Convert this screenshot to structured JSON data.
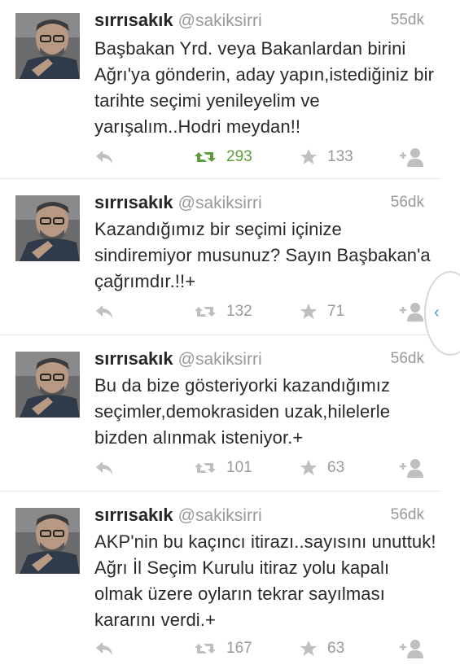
{
  "tweets": [
    {
      "name": "sırrısakık",
      "handle": "@sakiksirri",
      "time": "55dk",
      "text": "Başbakan Yrd. veya Bakanlardan birini Ağrı'ya gönderin, aday yapın,istediğiniz bir tarihte seçimi yenileyelim ve yarışalım..Hodri meydan!!",
      "retweets": "293",
      "favorites": "133",
      "retweeted": true
    },
    {
      "name": "sırrısakık",
      "handle": "@sakiksirri",
      "time": "56dk",
      "text": "Kazandığımız bir seçimi içinize sindiremiyor musunuz? Sayın Başbakan'a çağrımdır.!!+",
      "retweets": "132",
      "favorites": "71",
      "retweeted": false
    },
    {
      "name": "sırrısakık",
      "handle": "@sakiksirri",
      "time": "56dk",
      "text": "Bu da bize gösteriyorki kazandığımız seçimler,demokrasiden uzak,hilelerle bizden alınmak isteniyor.+",
      "retweets": "101",
      "favorites": "63",
      "retweeted": false
    },
    {
      "name": "sırrısakık",
      "handle": "@sakiksirri",
      "time": "56dk",
      "text": "AKP'nin bu kaçıncı itirazı..sayısını unuttuk! Ağrı İl Seçim Kurulu itiraz yolu kapalı olmak üzere oyların tekrar sayılması kararını verdi.+",
      "retweets": "167",
      "favorites": "63",
      "retweeted": false
    }
  ],
  "icons": {
    "reply": "reply-icon",
    "retweet": "retweet-icon",
    "favorite": "star-icon",
    "follow": "follow-icon",
    "side_tab": "chevron-left-icon"
  },
  "colors": {
    "retweeted": "#5c9c3c",
    "icon": "#bfbfbf",
    "muted": "#999999",
    "text": "#292929"
  },
  "side_tab": {
    "glyph": "‹"
  }
}
